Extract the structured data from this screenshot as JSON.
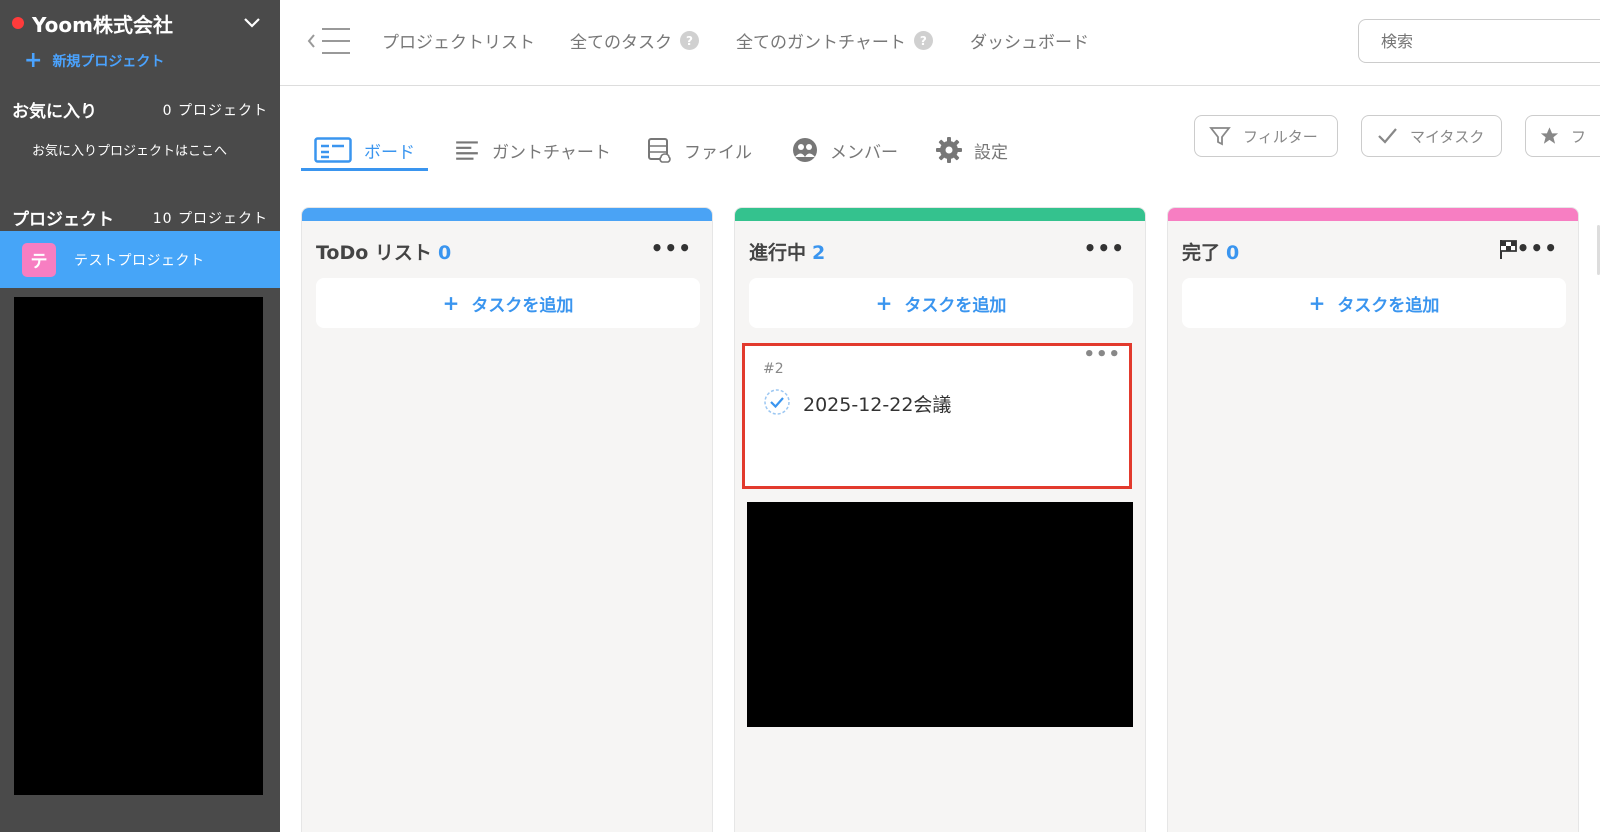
{
  "sidebar": {
    "org_name": "Yoom株式会社",
    "new_project": "新規プロジェクト",
    "favorites": {
      "title": "お気に入り",
      "count": "0 プロジェクト",
      "hint": "お気に入りプロジェクトはここへ"
    },
    "projects": {
      "title": "プロジェクト",
      "count": "10 プロジェクト",
      "items": [
        {
          "avatar": "テ",
          "label": "テストプロジェクト",
          "color": "#f77ec2"
        }
      ]
    }
  },
  "topnav": {
    "links": [
      "プロジェクトリスト",
      "全てのタスク",
      "全てのガントチャート",
      "ダッシュボード"
    ],
    "help": "?",
    "search_placeholder": "検索"
  },
  "tabs": [
    "ボード",
    "ガントチャート",
    "ファイル",
    "メンバー",
    "設定"
  ],
  "chips": [
    "フィルター",
    "マイタスク",
    "フ"
  ],
  "columns": [
    {
      "title": "ToDo リスト",
      "count": "0",
      "color": "#4aa3f5",
      "add_label": "タスクを追加"
    },
    {
      "title": "進行中",
      "count": "2",
      "color": "#34c28e",
      "add_label": "タスクを追加"
    },
    {
      "title": "完了",
      "count": "0",
      "color": "#f77ec2",
      "add_label": "タスクを追加"
    }
  ],
  "card": {
    "id": "#2",
    "title": "2025-12-22会議"
  },
  "colors": {
    "accent": "#3a95ef",
    "highlight": "#e23a2d",
    "sidebar": "#4a4a4a"
  }
}
